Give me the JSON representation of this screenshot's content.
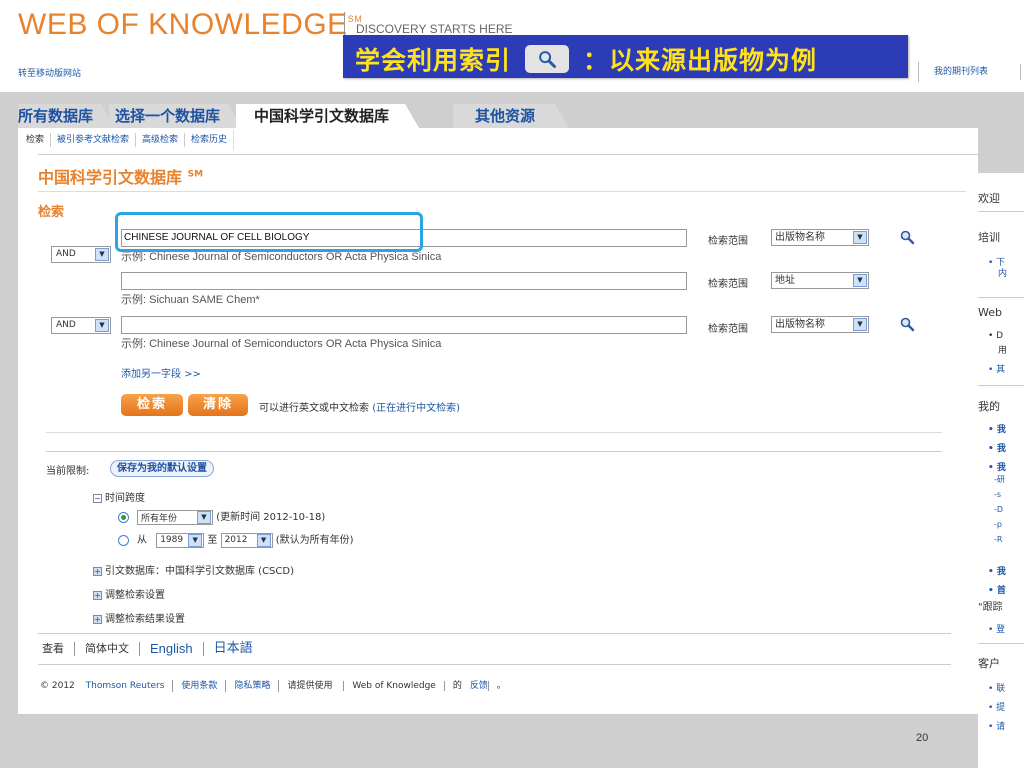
{
  "header": {
    "logo": "WEB OF KNOWLEDGE",
    "logo_mark": "SM",
    "tagline": "DISCOVERY STARTS HERE",
    "mobile_link": "转至移动版网站",
    "journal_list_link": "我的期刊列表"
  },
  "overlay": {
    "title_part1": "学会利用索引",
    "title_part2": "：以来源出版物为例"
  },
  "tabs": [
    {
      "label": "所有数据库"
    },
    {
      "label": "选择一个数据库"
    },
    {
      "label": "中国科学引文数据库"
    },
    {
      "label": "其他资源"
    }
  ],
  "subnav": [
    "检索",
    "被引参考文献检索",
    "高级检索",
    "检索历史"
  ],
  "db_title": "中国科学引文数据库",
  "db_title_mark": "SM",
  "search_heading": "检索",
  "fields": [
    {
      "value": "CHINESE JOURNAL OF CELL BIOLOGY",
      "example": "示例: Chinese Journal of Semiconductors OR Acta Physica Sinica",
      "scope_label": "检索范围",
      "scope": "出版物名称"
    },
    {
      "bool": "AND",
      "value": "",
      "example": "示例: Sichuan SAME Chem*",
      "scope_label": "检索范围",
      "scope": "地址"
    },
    {
      "bool": "AND",
      "value": "",
      "example": "示例: Chinese Journal of Semiconductors OR Acta Physica Sinica",
      "scope_label": "检索范围",
      "scope": "出版物名称"
    }
  ],
  "add_field": "添加另一字段 >>",
  "buttons": {
    "search": "检索",
    "clear": "清除"
  },
  "hint_text": "可以进行英文或中文检索",
  "hint_link": "(正在进行中文检索)",
  "limits": {
    "label": "当前限制:",
    "save_default": "保存为我的默认设置",
    "timespan_label": "时间跨度",
    "all_years": "所有年份",
    "update_info": "(更新时间 2012-10-18)",
    "from_label": "从",
    "from_year": "1989",
    "to_label": "至",
    "to_year": "2012",
    "default_note": "(默认为所有年份)",
    "citation_db": "引文数据库：中国科学引文数据库 (CSCD)",
    "adjust_search": "调整检索设置",
    "adjust_results": "调整检索结果设置"
  },
  "footer": {
    "view_label": "查看",
    "lang_zh": "简体中文",
    "lang_en": "English",
    "lang_ja": "日本語",
    "copyright": "© 2012",
    "thomson": "Thomson Reuters",
    "terms": "使用条款",
    "privacy": "隐私策略",
    "feedback_prefix": "请提供使用",
    "feedback_wok": "Web of Knowledge",
    "feedback_suffix": "的",
    "feedback_link": "反馈",
    "feedback_end": "。"
  },
  "sidebar": {
    "welcome": "欢迎",
    "training": "培训",
    "t1": "• 下",
    "t1b": "内",
    "web": "Web",
    "w1": "• D",
    "w1b": "用",
    "w2": "• 其",
    "my": "我的",
    "m1": "• 我",
    "m2": "• 我",
    "m3": "• 我",
    "m3a": "-研",
    "m3b": "-s",
    "m3c": "-D",
    "m3d": "-p",
    "m3e": "-R",
    "m4": "• 我",
    "m5": "• 首",
    "track": "\"跟踪",
    "m6": "• 登",
    "customer": "客户",
    "c1": "• 联",
    "c2": "• 提",
    "c3": "• 请"
  },
  "page_number": "20",
  "colors": {
    "accent_orange": "#e8822c",
    "link_blue": "#1e57a6",
    "overlay_bg": "#2b3cb6",
    "overlay_text": "#ffe11c",
    "highlight": "#2aa4e4"
  }
}
